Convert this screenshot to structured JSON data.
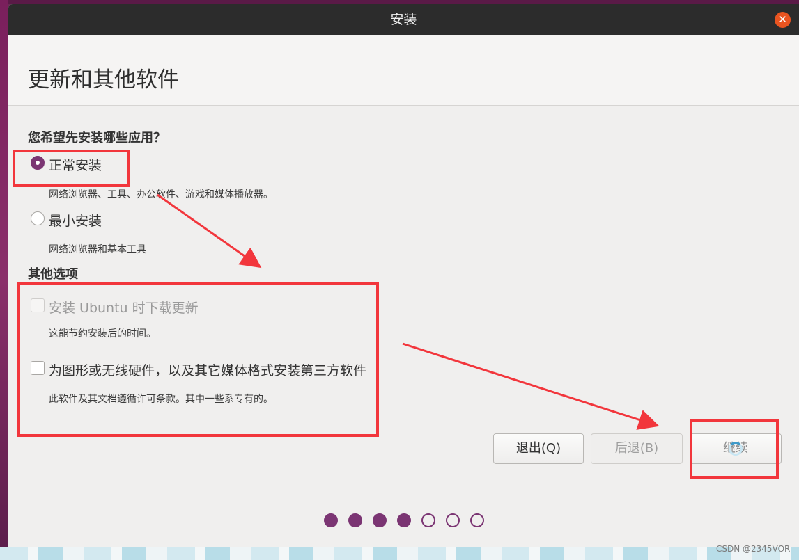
{
  "window": {
    "title": "安装",
    "close_icon": "close-icon"
  },
  "page": {
    "title": "更新和其他软件"
  },
  "apps_section": {
    "heading": "您希望先安装哪些应用？",
    "options": [
      {
        "label": "正常安装",
        "description": "网络浏览器、工具、办公软件、游戏和媒体播放器。",
        "selected": true
      },
      {
        "label": "最小安装",
        "description": "网络浏览器和基本工具",
        "selected": false
      }
    ]
  },
  "other_section": {
    "heading": "其他选项",
    "options": [
      {
        "label": "安装 Ubuntu 时下载更新",
        "description": "这能节约安装后的时间。",
        "checked": false,
        "disabled": true
      },
      {
        "label": "为图形或无线硬件，以及其它媒体格式安装第三方软件",
        "description": "此软件及其文档遵循许可条款。其中一些系专有的。",
        "checked": false,
        "disabled": false
      }
    ]
  },
  "buttons": {
    "quit": "退出(Q)",
    "back": "后退(B)",
    "continue": "继续"
  },
  "progress": {
    "total_steps": 7,
    "completed_steps": 4
  },
  "colors": {
    "accent": "#7b3573",
    "close": "#e95420",
    "annotation": "#f2363c"
  },
  "watermark": "CSDN @2345VOR"
}
